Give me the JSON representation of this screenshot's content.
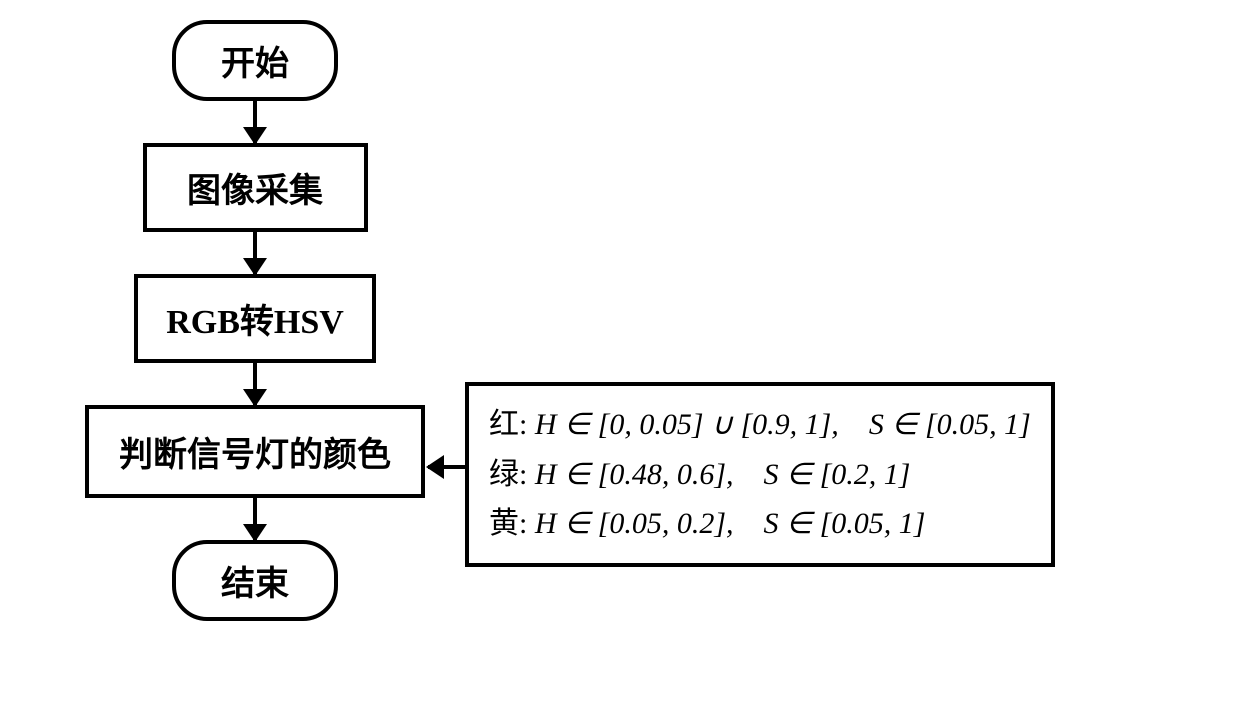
{
  "flow": {
    "start": "开始",
    "step1": "图像采集",
    "step2": "RGB转HSV",
    "step3": "判断信号灯的颜色",
    "end": "结束"
  },
  "criteria": {
    "red": {
      "label": "红:",
      "h": "H ∈ [0, 0.05] ∪ [0.9, 1],",
      "s": "S ∈ [0.05, 1]"
    },
    "green": {
      "label": "绿:",
      "h": "H ∈ [0.48, 0.6],",
      "s": "S ∈ [0.2, 1]"
    },
    "yellow": {
      "label": "黄:",
      "h": "H ∈ [0.05, 0.2],",
      "s": "S ∈ [0.05, 1]"
    }
  }
}
